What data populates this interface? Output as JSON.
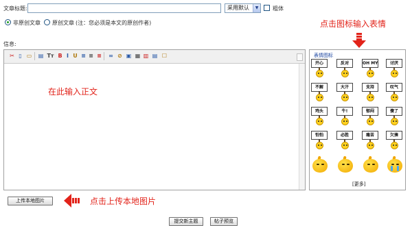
{
  "form": {
    "title_label": "文章标题:",
    "title_value": "",
    "style_select": "采用默认",
    "bold_label": "粗体",
    "bold_checked": false,
    "radio_original_label": "非原创文章",
    "radio_original_checked": true,
    "radio_author_label": "原创文章",
    "radio_author_note": "(注：您必须是本文的原创作者)",
    "message_label": "信息:"
  },
  "editor": {
    "toolbar_icons": [
      "cut-icon",
      "copy-icon",
      "paste-icon",
      "format-icon",
      "text-size-icon",
      "bold-icon",
      "italic-icon",
      "underline-icon",
      "align-left-icon",
      "align-center-icon",
      "align-right-icon",
      "link-icon",
      "unlink-icon",
      "image-icon",
      "flash-icon",
      "media-icon",
      "table-icon",
      "checkbox-icon"
    ],
    "toolbar_glyphs": [
      "✂",
      "▯",
      "▭",
      "▤",
      "Tт",
      "B",
      "I",
      "U",
      "≡",
      "≡",
      "≡",
      "∞",
      "⊘",
      "▣",
      "▦",
      "▥",
      "▤",
      "☐"
    ]
  },
  "emoticons": {
    "title": "表情图标",
    "signs": [
      [
        "开心",
        "反对",
        "OH MY GOD!",
        "讨厌"
      ],
      [
        "不解",
        "大汗",
        "支持",
        "叹气"
      ],
      [
        "鸡头",
        "牛!",
        "郁闷",
        "傻了"
      ],
      [
        "怕怕",
        "必胜",
        "痛苦",
        "欠揍"
      ]
    ],
    "more_label": "[更多]"
  },
  "buttons": {
    "upload": "上传本地图片",
    "submit": "提交新主题",
    "preview": "帖子预览"
  },
  "annotations": {
    "emoticon_hint": "点击图标输入表情",
    "body_hint": "在此输入正文",
    "upload_hint": "点击上传本地图片"
  },
  "colors": {
    "annotation_red": "#e2231a",
    "panel_title_blue": "#1a44a0"
  }
}
